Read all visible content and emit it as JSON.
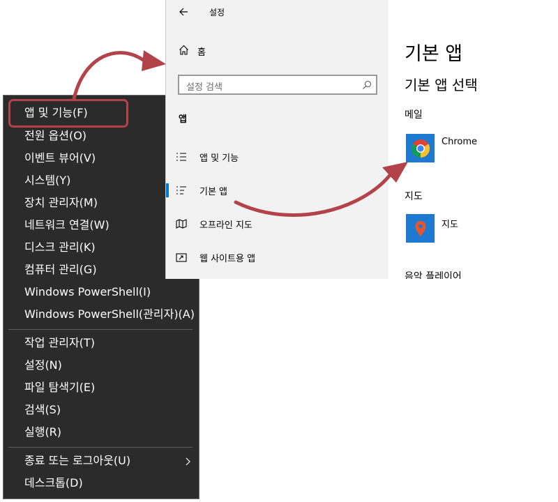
{
  "menu": {
    "items": [
      {
        "label": "앱 및 기능(F)"
      },
      {
        "label": "전원 옵션(O)"
      },
      {
        "label": "이벤트 뷰어(V)"
      },
      {
        "label": "시스템(Y)"
      },
      {
        "label": "장치 관리자(M)"
      },
      {
        "label": "네트워크 연결(W)"
      },
      {
        "label": "디스크 관리(K)"
      },
      {
        "label": "컴퓨터 관리(G)"
      },
      {
        "label": "Windows PowerShell(I)"
      },
      {
        "label": "Windows PowerShell(관리자)(A)"
      },
      {
        "label": "작업 관리자(T)"
      },
      {
        "label": "설정(N)"
      },
      {
        "label": "파일 탐색기(E)"
      },
      {
        "label": "검색(S)"
      },
      {
        "label": "실행(R)"
      },
      {
        "label": "종료 또는 로그아웃(U)"
      },
      {
        "label": "데스크톱(D)"
      }
    ],
    "submenu_icon": "chevron-right-icon"
  },
  "settings": {
    "title": "설정",
    "home_label": "홈",
    "search_placeholder": "설정 검색",
    "section_label": "앱",
    "nav_items": [
      {
        "label": "앱 및 기능",
        "icon": "list-icon"
      },
      {
        "label": "기본 앱",
        "icon": "default-apps-icon",
        "active": true
      },
      {
        "label": "오프라인 지도",
        "icon": "map-icon"
      },
      {
        "label": "웹 사이트용 앱",
        "icon": "web-app-icon"
      }
    ],
    "content": {
      "title": "기본 앱",
      "subtitle": "기본 앱 선택",
      "email_heading": "메일",
      "email_app": "Chrome",
      "maps_heading": "지도",
      "maps_app": "지도",
      "music_heading": "음악 플레이어"
    }
  },
  "colors": {
    "accent": "#0078d7",
    "annotation": "#b3434a",
    "menu_bg": "#2b2b2b"
  }
}
